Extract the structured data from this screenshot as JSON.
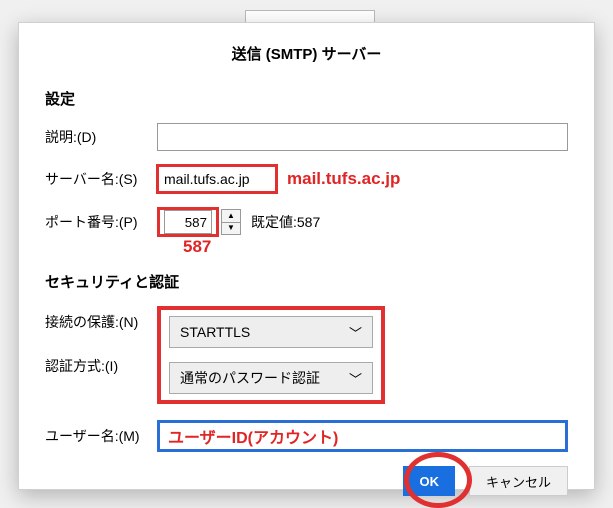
{
  "dialog": {
    "title": "送信 (SMTP) サーバー",
    "section_settings": "設定",
    "section_security": "セキュリティと認証",
    "labels": {
      "description": "説明:(D)",
      "server": "サーバー名:(S)",
      "port": "ポート番号:(P)",
      "default_port": "既定値:587",
      "conn_security": "接続の保護:(N)",
      "auth_method": "認証方式:(I)",
      "username": "ユーザー名:(M)"
    },
    "values": {
      "description": "",
      "server": "mail.tufs.ac.jp",
      "port": "587",
      "conn_security": "STARTTLS",
      "auth_method": "通常のパスワード認証",
      "username_placeholder": "ユーザーID(アカウント)"
    },
    "annotations": {
      "server": "mail.tufs.ac.jp",
      "port": "587"
    },
    "buttons": {
      "ok": "OK",
      "cancel": "キャンセル"
    }
  }
}
